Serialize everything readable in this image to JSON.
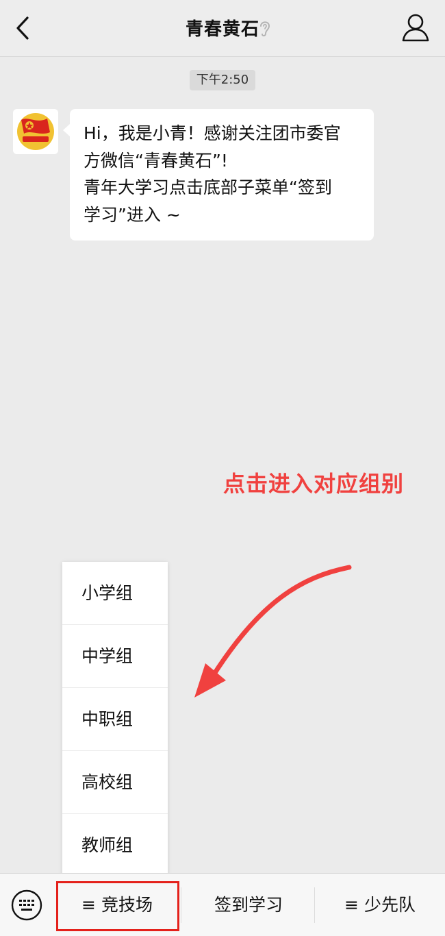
{
  "header": {
    "title": "青春黄石",
    "back_icon": "back-chevron-icon",
    "ear_icon": "ear-icon",
    "profile_icon": "person-icon"
  },
  "chat": {
    "timestamp": "下午2:50",
    "message": {
      "lines": [
        "Hi，我是小青！感谢关注团市委官",
        "方微信“青春黄石”!",
        "青年大学习点击底部子菜单“签到",
        "学习”进入 ~"
      ]
    },
    "annotation": "点击进入对应组别",
    "annotation_color": "#f0413f"
  },
  "popup_menu": {
    "items": [
      "小学组",
      "中学组",
      "中职组",
      "高校组",
      "教师组"
    ]
  },
  "bottom_bar": {
    "keyboard_icon": "keyboard-icon",
    "tabs": [
      {
        "label": "≡ 竞技场"
      },
      {
        "label": "签到学习"
      },
      {
        "label": "≡ 少先队"
      }
    ],
    "highlight_color": "#e4211b"
  }
}
